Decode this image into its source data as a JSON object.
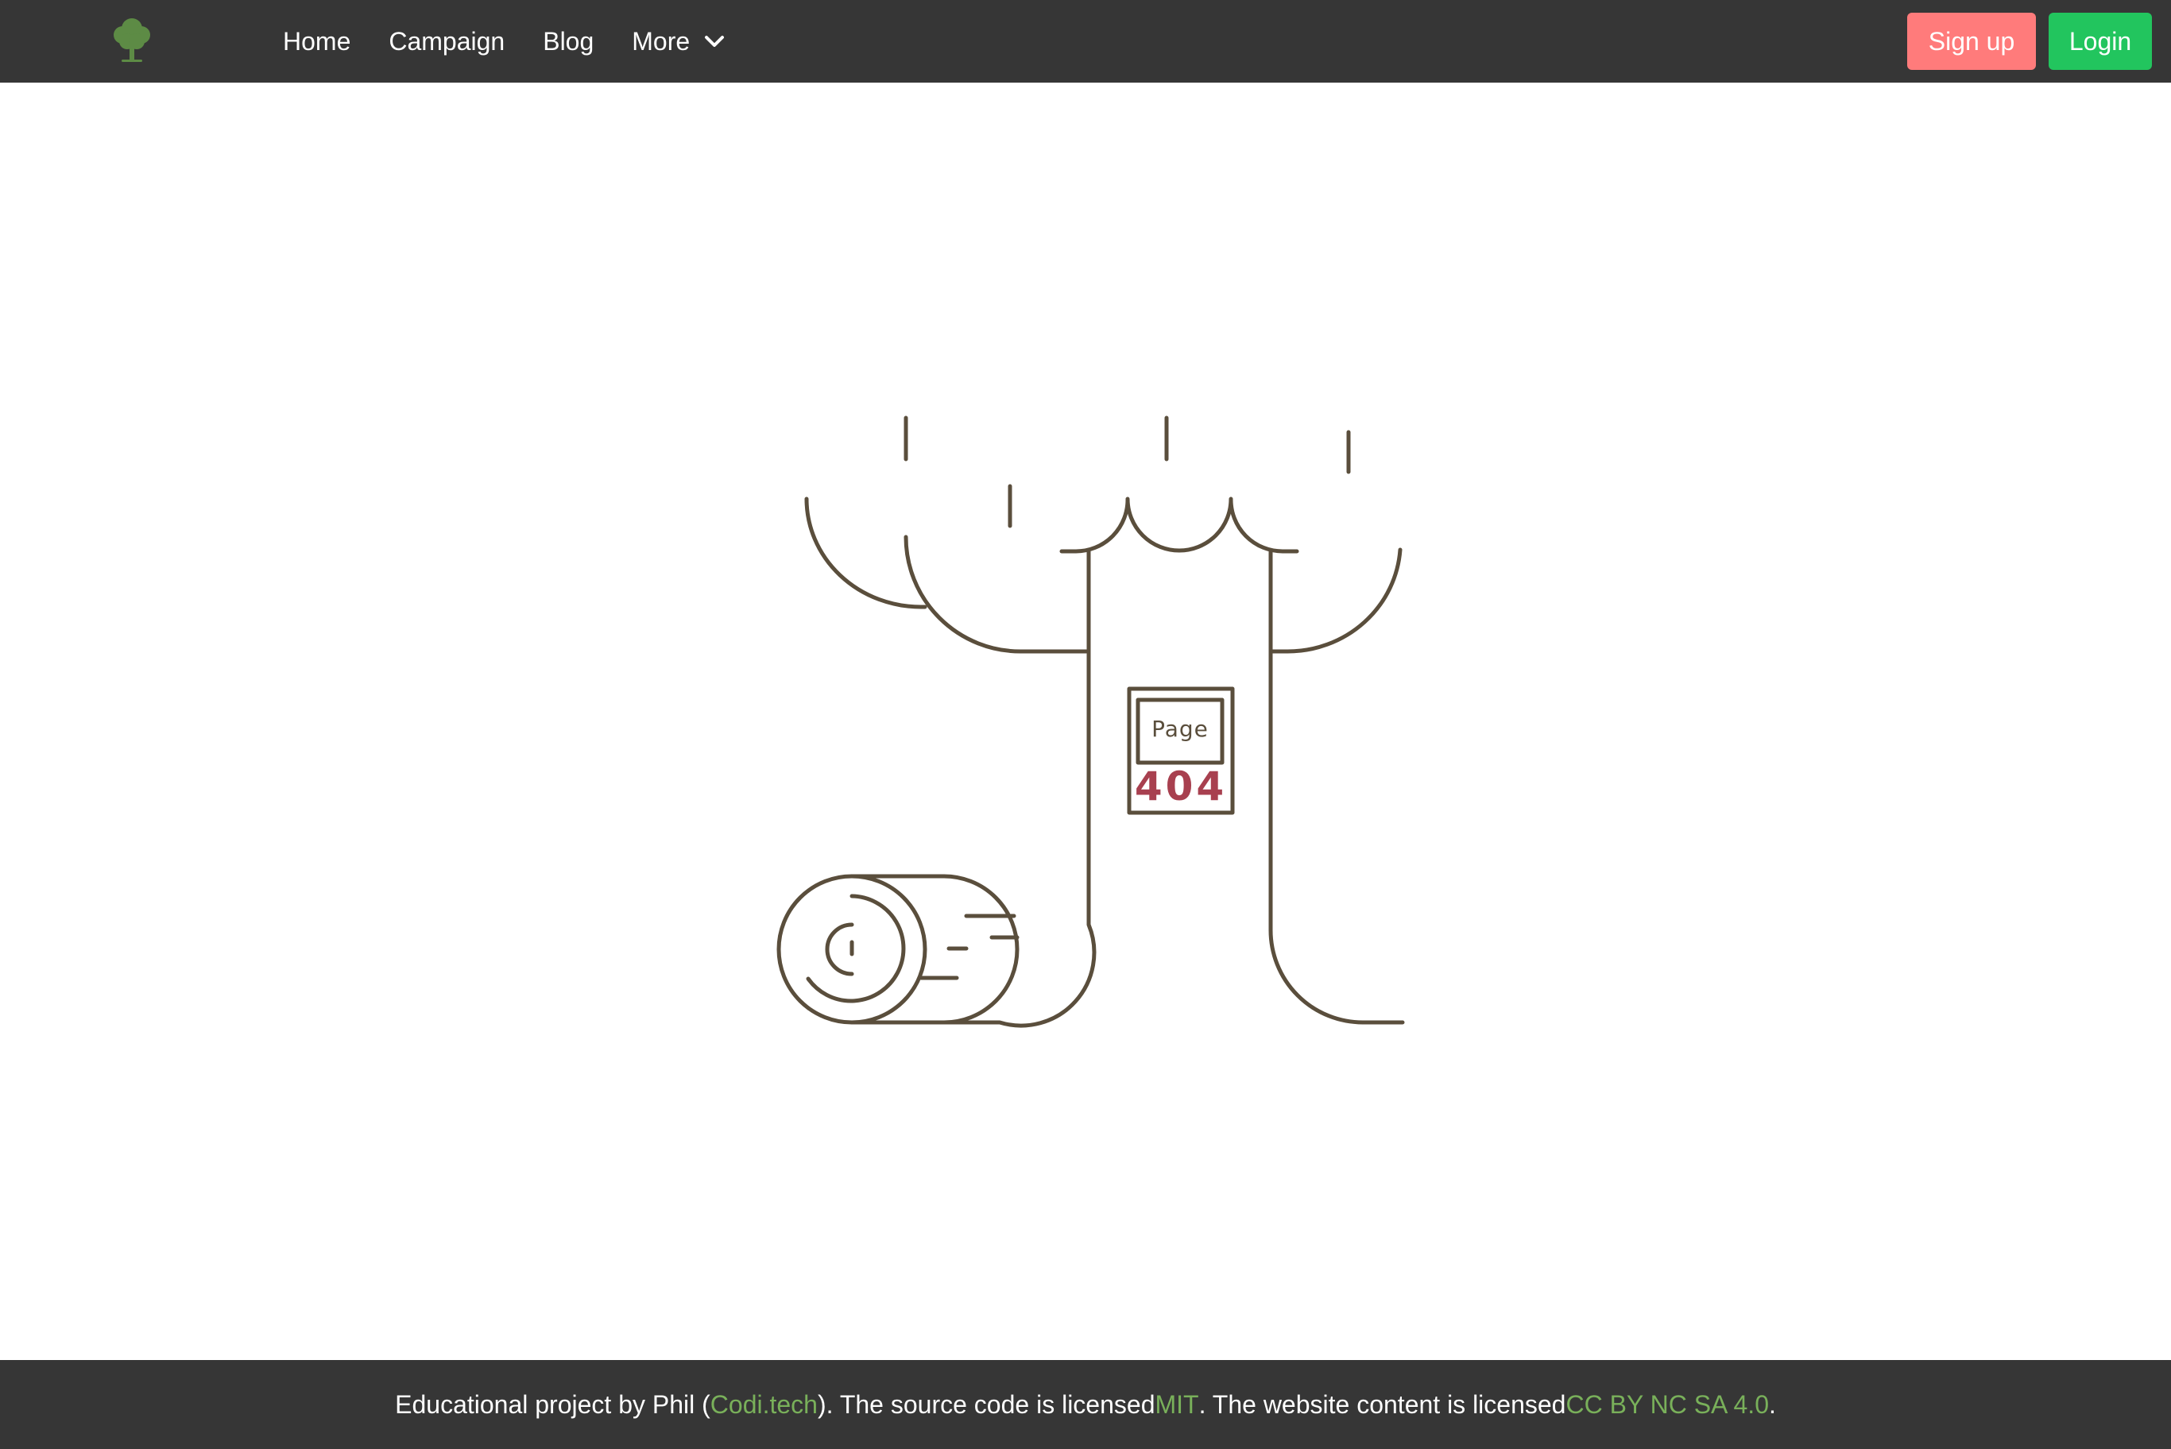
{
  "navbar": {
    "logo_icon": "tree-icon",
    "links": [
      {
        "label": "Home"
      },
      {
        "label": "Campaign"
      },
      {
        "label": "Blog"
      },
      {
        "label": "More",
        "icon": "chevron-down-icon"
      }
    ],
    "signup_label": "Sign up",
    "login_label": "Login"
  },
  "error_sign": {
    "line1": "Page",
    "line2": "404"
  },
  "footer": {
    "text_1": "Educational project by Phil (",
    "link_codi": "Codi.tech",
    "text_2": "). The source code is licensed ",
    "link_mit": "MIT",
    "text_3": ". The website content is licensed ",
    "link_cc": "CC BY NC SA 4.0",
    "text_4": "."
  },
  "colors": {
    "nav_bg": "#363636",
    "signup_bg": "#ff7b7b",
    "login_bg": "#22c55e",
    "link_green": "#79b05a",
    "line_brown": "#5a4e3c",
    "error_red": "#a8404f"
  }
}
